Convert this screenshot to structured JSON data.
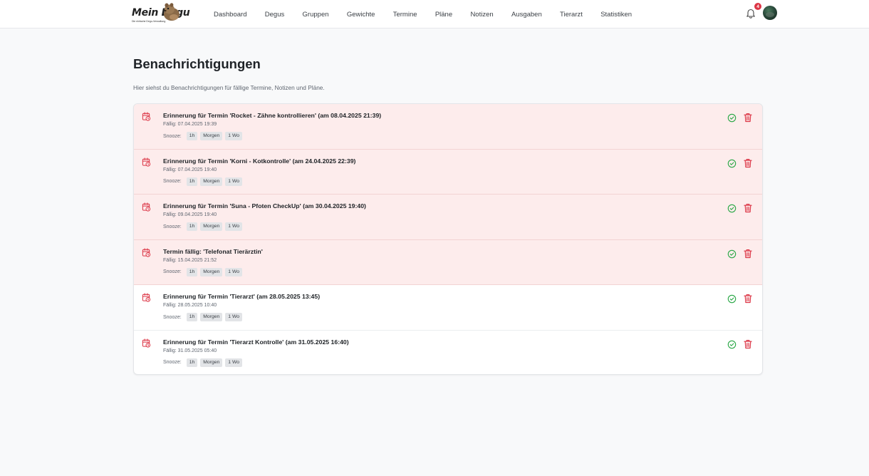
{
  "logo": {
    "title": "Mein Degu",
    "subtitle": "Die einfache Degu-Verwaltung"
  },
  "nav": [
    {
      "label": "Dashboard"
    },
    {
      "label": "Degus"
    },
    {
      "label": "Gruppen"
    },
    {
      "label": "Gewichte"
    },
    {
      "label": "Termine"
    },
    {
      "label": "Pläne"
    },
    {
      "label": "Notizen"
    },
    {
      "label": "Ausgaben"
    },
    {
      "label": "Tierarzt"
    },
    {
      "label": "Statistiken"
    }
  ],
  "notifications_badge": "4",
  "page": {
    "title": "Benachrichtigungen",
    "description": "Hier siehst du Benachrichtigungen für fällige Termine, Notizen und Pläne."
  },
  "snooze_label": "Snooze:",
  "snooze_options": [
    "1h",
    "Morgen",
    "1 Wo"
  ],
  "colors": {
    "overdue_bg": "#fdecec",
    "check": "#28a745",
    "delete": "#dc3545"
  },
  "items": [
    {
      "title": "Erinnerung für Termin 'Rocket - Zähne kontrollieren' (am 08.04.2025 21:39)",
      "due": "Fällig: 07.04.2025 19:39",
      "overdue": true
    },
    {
      "title": "Erinnerung für Termin 'Korni - Kotkontrolle' (am 24.04.2025 22:39)",
      "due": "Fällig: 07.04.2025 19:40",
      "overdue": true
    },
    {
      "title": "Erinnerung für Termin 'Suna - Pfoten CheckUp' (am 30.04.2025 19:40)",
      "due": "Fällig: 09.04.2025 19:40",
      "overdue": true
    },
    {
      "title": "Termin fällig: 'Telefonat Tierärztin'",
      "due": "Fällig: 15.04.2025 21:52",
      "overdue": true
    },
    {
      "title": "Erinnerung für Termin 'Tierarzt' (am 28.05.2025 13:45)",
      "due": "Fällig: 28.05.2025 10:40",
      "overdue": false
    },
    {
      "title": "Erinnerung für Termin 'Tierarzt Kontrolle' (am 31.05.2025 16:40)",
      "due": "Fällig: 31.05.2025 05:40",
      "overdue": false
    }
  ]
}
